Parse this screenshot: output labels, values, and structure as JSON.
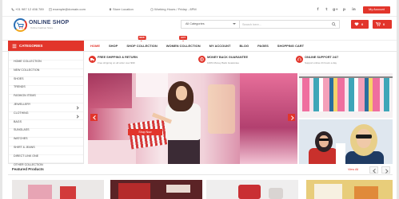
{
  "theme": {
    "accent": "#e2352b",
    "text": "#333333"
  },
  "topbar": {
    "phone": "+01 987 12 456 789",
    "email": "example@domain.com",
    "location": "Store Location",
    "hours": "Working Hours / Friday - 8PM",
    "social": [
      {
        "icon": "facebook-icon",
        "glyph": "f"
      },
      {
        "icon": "twitter-icon",
        "glyph": "t"
      },
      {
        "icon": "google-plus-icon",
        "glyph": "g+"
      },
      {
        "icon": "pinterest-icon",
        "glyph": "p"
      },
      {
        "icon": "linkedin-icon",
        "glyph": "in"
      }
    ],
    "account_label": "My Account"
  },
  "header": {
    "logo": {
      "title": "ONLINE SHOP",
      "tagline": "Online Fashion Store"
    },
    "search": {
      "category": "All Categories",
      "placeholder": "Search here..."
    },
    "wishlist_count": "0",
    "cart_count": "0"
  },
  "nav": {
    "categories_label": "CATEGORIES",
    "items": [
      {
        "label": "HOME",
        "active": true
      },
      {
        "label": "SHOP"
      },
      {
        "label": "SHOP COLLECTION",
        "badge": "NEW"
      },
      {
        "label": "WOMEN COLLECTION",
        "badge": "HOT"
      },
      {
        "label": "MY ACCOUNT"
      },
      {
        "label": "BLOG"
      },
      {
        "label": "PAGES"
      },
      {
        "label": "SHOPPING CART"
      }
    ]
  },
  "sidebar": {
    "categories": [
      "HOME COLLECTION",
      "NEW COLLECTION",
      "SHOES",
      "TRENDS",
      "FASHION ITEMS",
      "JEWELLERY",
      "CLOTHING",
      "BAGS",
      "SUNGLASS",
      "WATCHES",
      "SHIRT & JEANS",
      "DIRECT LINK ONE",
      "OTHER COLLECTION"
    ]
  },
  "features": [
    {
      "icon": "truck-icon",
      "title": "FREE SHIPPING & RETURN",
      "subtitle": "Free shipping on all order over $99"
    },
    {
      "icon": "money-back-icon",
      "title": "MONEY BACK GUARANTEE",
      "subtitle": "100% Money Back Guarantee"
    },
    {
      "icon": "support-icon",
      "title": "ONLINE SUPPORT 24/7",
      "subtitle": "Support online 24 hours a day"
    }
  ],
  "slider": {
    "cta_label": "Shop Now"
  },
  "featured": {
    "title": "Featured Products",
    "view_all": "View All"
  }
}
